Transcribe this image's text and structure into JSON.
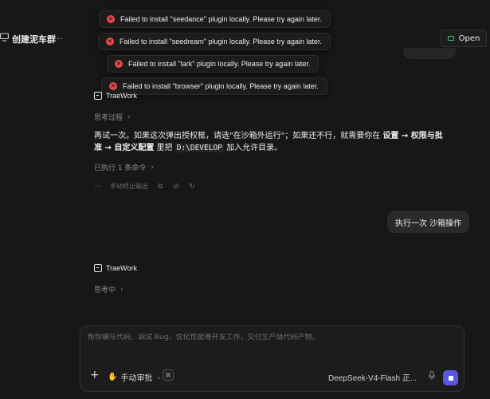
{
  "header": {
    "title": "创建泥车群",
    "more_icon": "…",
    "open_label": "Open"
  },
  "toasts": [
    "Failed to install \"seedance\" plugin locally. Please try again later.",
    "Failed to install \"seedream\" plugin locally. Please try again later.",
    "Failed to install \"lark\" plugin locally. Please try again later.",
    "Failed to install \"browser\" plugin locally. Please try again later."
  ],
  "messages": {
    "first": {
      "author": "TraeWork",
      "thinking_label": "思考过程",
      "answer_part1": "再试一次。如果这次弹出授权框，请选\"在沙箱外运行\"；如果还不行，就需要你在 ",
      "answer_bold": "设置 → 权限与批准 → 自定义配置",
      "answer_part2": " 里把 ",
      "answer_code": "D:\\DEVELOP",
      "answer_part3": " 加入允许目录。",
      "executed_label": "已执行 1 条命令",
      "manual_stop_label": "手动终止输出"
    },
    "user": {
      "text": "执行一次 沙箱操作"
    },
    "second": {
      "author": "TraeWork",
      "thinking_label": "思考中"
    }
  },
  "composer": {
    "placeholder": "帮你编写代码、调试 Bug、优化性能等开发工作，交付生产级代码产物。",
    "approve_label": "手动审批",
    "model_label": "DeepSeek-V4-Flash 正...",
    "plus_icon": "+"
  },
  "colors": {
    "background": "#171717",
    "error": "#e5484d",
    "send": "#5b57e6",
    "open_icon": "#3fbf6a"
  }
}
